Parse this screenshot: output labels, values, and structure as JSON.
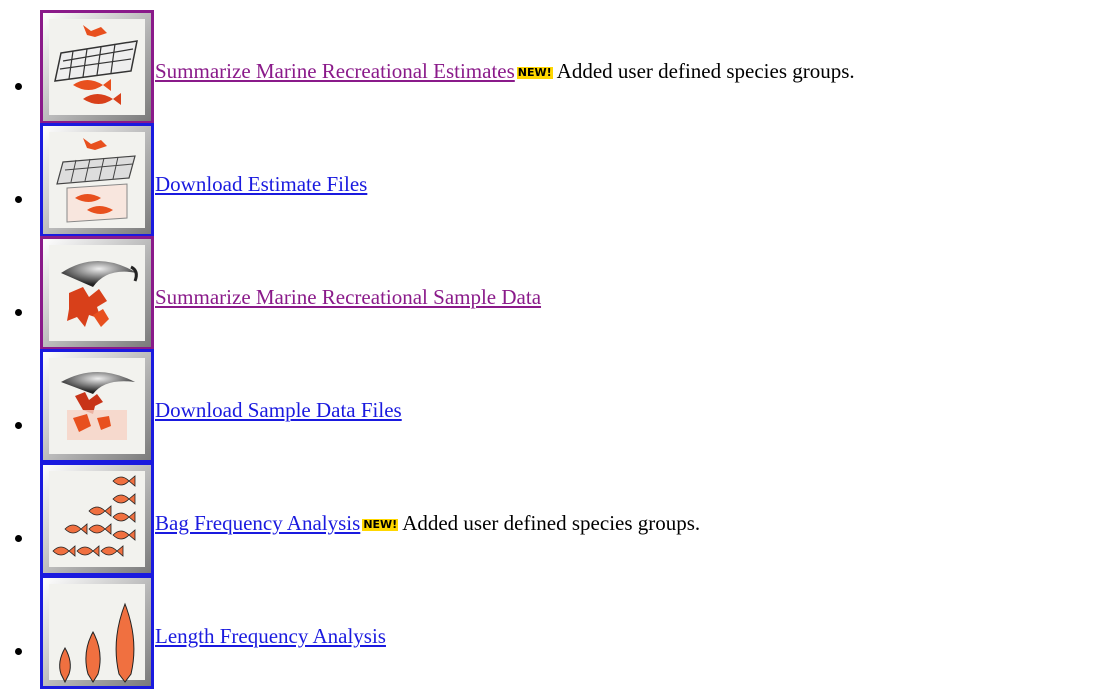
{
  "items": [
    {
      "label": "Summarize Marine Recreational Estimates",
      "visited": true,
      "badge": "NEW!",
      "note": "Added user defined species groups.",
      "icon": "fish-grid-estimates-icon"
    },
    {
      "label": "Download Estimate Files",
      "visited": false,
      "badge": "",
      "note": "",
      "icon": "fish-box-download-icon"
    },
    {
      "label": "Summarize Marine Recreational Sample Data",
      "visited": true,
      "badge": "",
      "note": "",
      "icon": "fishing-net-sample-icon"
    },
    {
      "label": "Download Sample Data Files",
      "visited": false,
      "badge": "",
      "note": "",
      "icon": "net-download-icon"
    },
    {
      "label": "Bag Frequency Analysis",
      "visited": false,
      "badge": "NEW!",
      "note": "Added user defined species groups.",
      "icon": "fish-bag-frequency-icon"
    },
    {
      "label": "Length Frequency Analysis",
      "visited": false,
      "badge": "",
      "note": "",
      "icon": "fish-length-frequency-icon"
    }
  ],
  "colors": {
    "link": "#1a1adf",
    "visited": "#8a1a8a",
    "badge": "#ffd700",
    "fish": "#f05a28"
  }
}
